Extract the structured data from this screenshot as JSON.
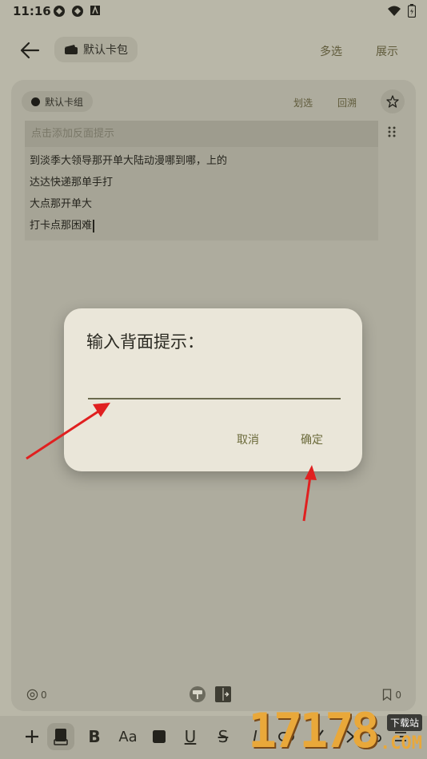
{
  "status": {
    "time": "11:16"
  },
  "appbar": {
    "pack_label": "默认卡包",
    "multi_select": "多选",
    "show": "展示"
  },
  "card": {
    "group_label": "默认卡组",
    "action_select": "划选",
    "action_recall": "回溯",
    "hint_placeholder": "点击添加反面提示",
    "lines": [
      "到淡季大领导那开单大陆动漫哪到哪，上的",
      "达达快递那单手打",
      "大点那开单大",
      "打卡点那困难"
    ],
    "footer_left_count": "0",
    "footer_right_count": "0"
  },
  "dialog": {
    "title": "输入背面提示：",
    "input_value": "",
    "cancel": "取消",
    "confirm": "确定"
  },
  "watermark": {
    "numbers": "17178",
    "badge": "下载站",
    "domain": ".COM"
  },
  "colors": {
    "annotation_arrow": "#e02020",
    "accent": "#6b6a3a"
  }
}
